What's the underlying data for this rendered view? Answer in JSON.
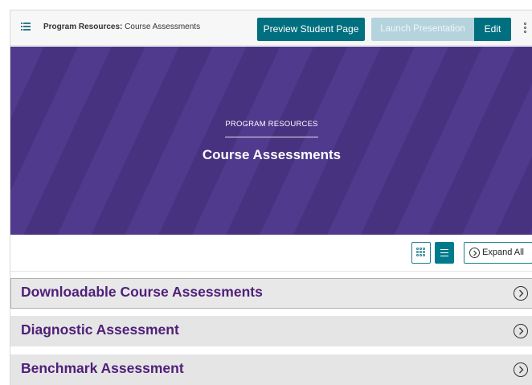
{
  "header": {
    "breadcrumb_parent": "Program Resources:",
    "breadcrumb_current": "Course Assessments",
    "preview_label": "Preview Student Page",
    "launch_label": "Launch Presentation",
    "edit_label": "Edit"
  },
  "hero": {
    "eyebrow": "PROGRAM RESOURCES",
    "title": "Course Assessments"
  },
  "toolbar": {
    "expand_label": "Expand All",
    "active_view": "list"
  },
  "sections": [
    {
      "title": "Downloadable Course Assessments"
    },
    {
      "title": "Diagnostic Assessment"
    },
    {
      "title": "Benchmark Assessment"
    }
  ],
  "colors": {
    "primary_button": "#006f7f",
    "disabled_button": "#b5d3dc",
    "hero_purple": "#4f3a8d",
    "section_title": "#4f1f7a"
  }
}
